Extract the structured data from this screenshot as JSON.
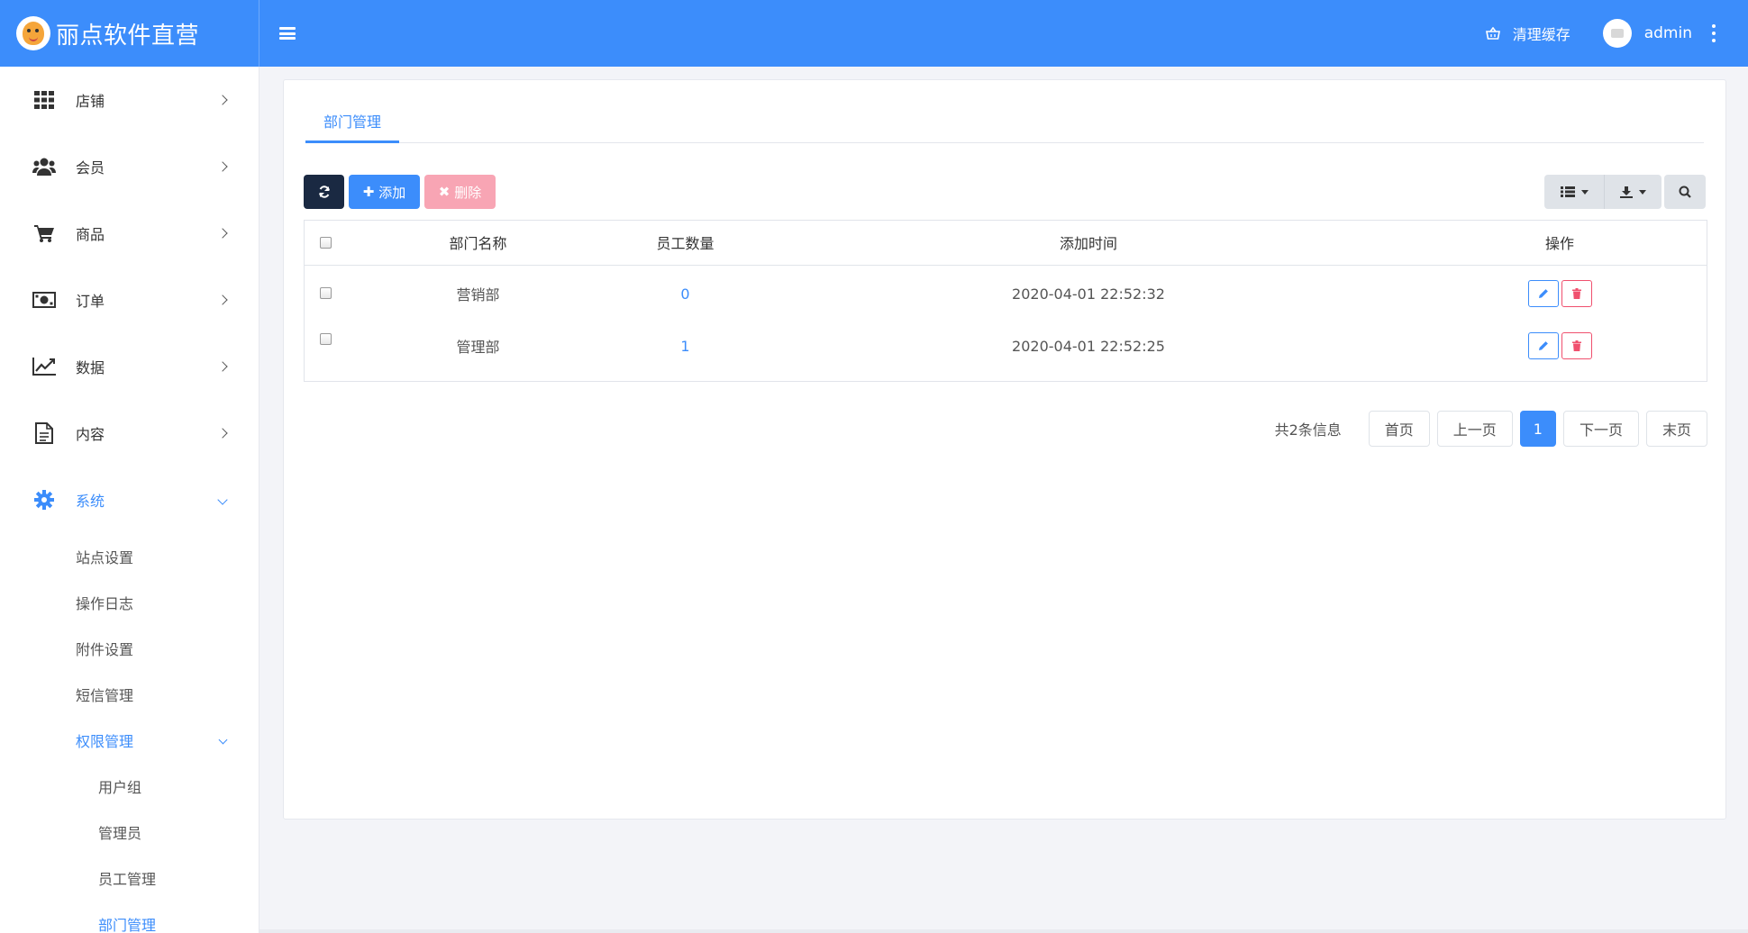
{
  "header": {
    "brand_title": "丽点软件直营",
    "clear_cache": "清理缓存",
    "username": "admin"
  },
  "sidebar": {
    "items": [
      {
        "label": "店铺",
        "icon": "grid-icon"
      },
      {
        "label": "会员",
        "icon": "users-icon"
      },
      {
        "label": "商品",
        "icon": "cart-icon"
      },
      {
        "label": "订单",
        "icon": "money-icon"
      },
      {
        "label": "数据",
        "icon": "chart-icon"
      },
      {
        "label": "内容",
        "icon": "file-icon"
      },
      {
        "label": "系统",
        "icon": "gear-icon"
      }
    ],
    "system_sub": [
      "站点设置",
      "操作日志",
      "附件设置",
      "短信管理"
    ],
    "permission_label": "权限管理",
    "permission_sub": [
      "用户组",
      "管理员",
      "员工管理",
      "部门管理"
    ]
  },
  "tabs": {
    "active": "部门管理"
  },
  "toolbar": {
    "add": "添加",
    "delete": "删除"
  },
  "table": {
    "headers": [
      "部门名称",
      "员工数量",
      "添加时间",
      "操作"
    ],
    "rows": [
      {
        "name": "营销部",
        "count": "0",
        "time": "2020-04-01 22:52:32"
      },
      {
        "name": "管理部",
        "count": "1",
        "time": "2020-04-01 22:52:25"
      }
    ]
  },
  "pager": {
    "info": "共2条信息",
    "first": "首页",
    "prev": "上一页",
    "current": "1",
    "next": "下一页",
    "last": "末页"
  },
  "colors": {
    "primary": "#3c8dfb",
    "dark": "#1a2942",
    "danger_light": "#f8a5b4",
    "danger": "#f0506e"
  }
}
